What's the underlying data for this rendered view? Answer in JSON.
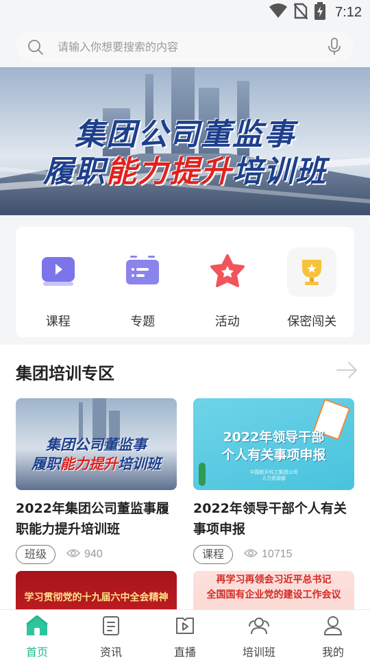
{
  "status_bar": {
    "time": "7:12",
    "icons": [
      "wifi-icon",
      "no-sim-icon",
      "battery-charging-icon"
    ]
  },
  "search": {
    "placeholder": "请输入你想要搜索的内容"
  },
  "banner": {
    "line1": "集团公司董监事",
    "line2_blue_a": "履职",
    "line2_red": "能力提升",
    "line2_blue_b": "培训班"
  },
  "quick_links": [
    {
      "label": "课程",
      "icon": "video-icon",
      "color": "#7c74ea"
    },
    {
      "label": "专题",
      "icon": "topic-list-icon",
      "color": "#8a84ec"
    },
    {
      "label": "活动",
      "icon": "star-badge-icon",
      "color": "#f2545b"
    },
    {
      "label": "保密闯关",
      "icon": "trophy-icon",
      "color": "#f6c23a"
    }
  ],
  "section": {
    "title": "集团培训专区",
    "more_icon": "arrow-right-icon"
  },
  "courses": [
    {
      "title": "2022年集团公司董监事履职能力提升培训班",
      "tag": "班级",
      "views": "940",
      "thumb_line1": "集团公司董监事",
      "thumb_line2_blue_a": "履职",
      "thumb_line2_red": "能力提升",
      "thumb_line2_blue_b": "培训班"
    },
    {
      "title": "2022年领导干部个人有关事项申报",
      "tag": "课程",
      "views": "10715",
      "thumb_line1": "2022年领导干部",
      "thumb_line2": "个人有关事项申报",
      "thumb_small": "中国航天科工集团公司\n人力资源部"
    },
    {
      "thumb_text": "学习贯彻党的十九届六中全会精神"
    },
    {
      "thumb_text1": "再学习再领会习近平总书记",
      "thumb_text2": "全国国有企业党的建设工作会议"
    }
  ],
  "bottom_nav": [
    {
      "label": "首页",
      "icon": "home-icon",
      "active": true
    },
    {
      "label": "资讯",
      "icon": "news-icon",
      "active": false
    },
    {
      "label": "直播",
      "icon": "live-icon",
      "active": false
    },
    {
      "label": "培训班",
      "icon": "training-class-icon",
      "active": false
    },
    {
      "label": "我的",
      "icon": "profile-icon",
      "active": false
    }
  ],
  "colors": {
    "accent": "#1fb98e",
    "banner_blue": "#1d3f8c",
    "banner_red": "#e0221f"
  }
}
